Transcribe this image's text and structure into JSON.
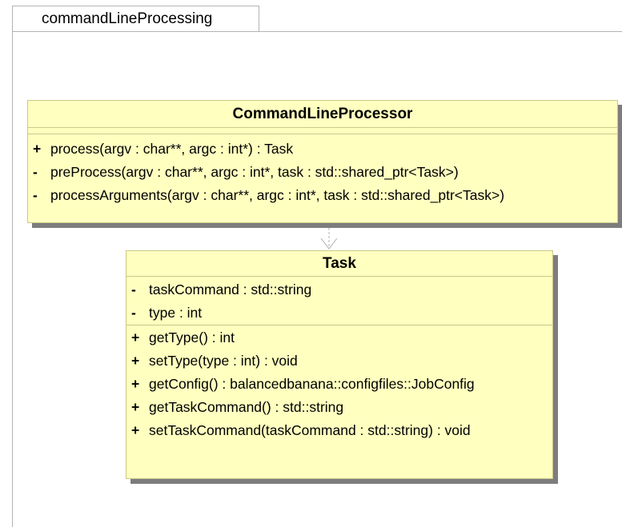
{
  "package": {
    "name": "commandLineProcessing"
  },
  "classes": {
    "command_line_processor": {
      "name": "CommandLineProcessor",
      "operations": [
        {
          "vis": "+",
          "text": "process(argv : char**, argc : int*) : Task"
        },
        {
          "vis": "-",
          "text": "preProcess(argv : char**, argc : int*, task : std::shared_ptr<Task>)"
        },
        {
          "vis": "-",
          "text": "processArguments(argv : char**, argc : int*, task : std::shared_ptr<Task>)"
        }
      ]
    },
    "task": {
      "name": "Task",
      "attributes": [
        {
          "vis": "-",
          "text": "taskCommand : std::string"
        },
        {
          "vis": "-",
          "text": "type : int"
        }
      ],
      "operations": [
        {
          "vis": "+",
          "text": "getType() : int"
        },
        {
          "vis": "+",
          "text": "setType(type : int) : void"
        },
        {
          "vis": "+",
          "text": "getConfig() : balancedbanana::configfiles::JobConfig"
        },
        {
          "vis": "+",
          "text": "getTaskCommand() : std::string"
        },
        {
          "vis": "+",
          "text": "setTaskCommand(taskCommand : std::string) : void"
        }
      ]
    }
  },
  "colors": {
    "class_fill": "#ffffc0",
    "class_border": "#c9c98a",
    "shadow": "#7d7d7d",
    "frame": "#b3b3b3",
    "dependency": "#b0b0b0"
  }
}
